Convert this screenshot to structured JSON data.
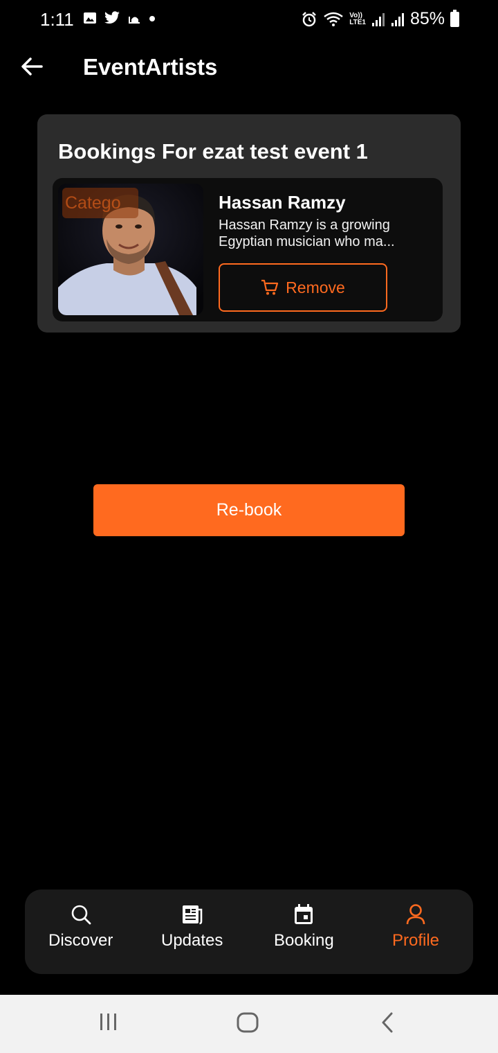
{
  "status_bar": {
    "time": "1:11",
    "battery": "85%",
    "left_icons": [
      "gallery-icon",
      "twitter-icon",
      "mosque-icon",
      "dot-icon"
    ],
    "right_icons": [
      "alarm-icon",
      "wifi-icon",
      "volte-icon",
      "signal-icon",
      "signal-icon",
      "battery-icon"
    ],
    "volte_label": "Vo))",
    "lte_label": "LTE1"
  },
  "header": {
    "title": "EventArtists",
    "back_icon": "arrow-left-icon"
  },
  "bookings": {
    "title": "Bookings For ezat test event 1",
    "items": [
      {
        "category_tag": "Catego",
        "name": "Hassan Ramzy",
        "description_line1": "Hassan Ramzy is a growing",
        "description_line2": "Egyptian musician who ma...",
        "remove_label": "Remove",
        "remove_icon": "cart-icon"
      }
    ]
  },
  "actions": {
    "rebook_label": "Re-book"
  },
  "bottom_nav": {
    "items": [
      {
        "label": "Discover",
        "icon": "search-icon",
        "active": false
      },
      {
        "label": "Updates",
        "icon": "newspaper-icon",
        "active": false
      },
      {
        "label": "Booking",
        "icon": "calendar-icon",
        "active": false
      },
      {
        "label": "Profile",
        "icon": "person-icon",
        "active": true
      }
    ]
  },
  "colors": {
    "accent": "#ff6a1f",
    "background": "#000000",
    "card": "#2c2c2c",
    "nav": "#1a1a1a"
  }
}
